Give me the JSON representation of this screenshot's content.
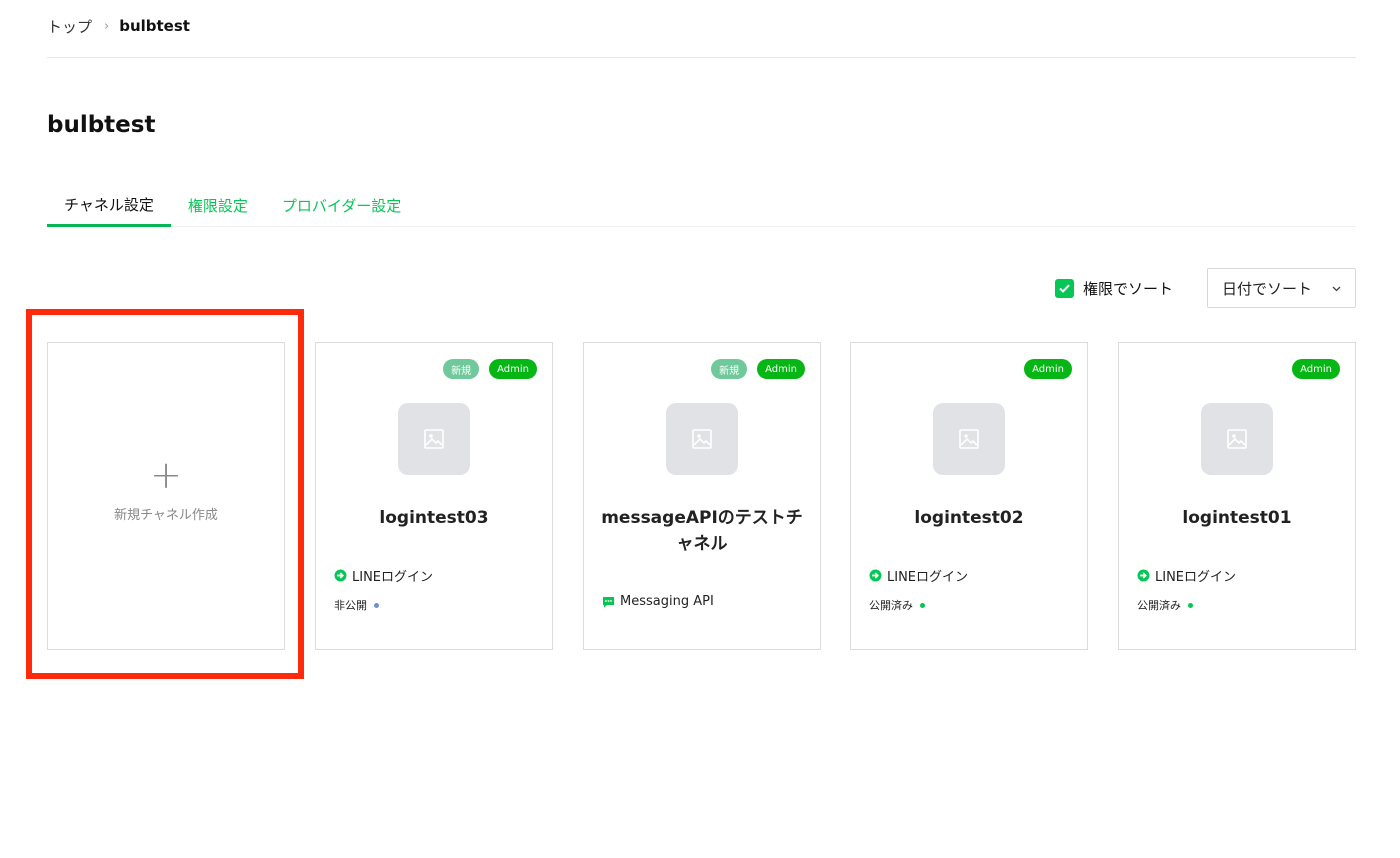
{
  "breadcrumb": {
    "home": "トップ",
    "separator": "›",
    "current": "bulbtest"
  },
  "page_title": "bulbtest",
  "tabs": [
    {
      "label": "チャネル設定",
      "active": true
    },
    {
      "label": "権限設定",
      "active": false
    },
    {
      "label": "プロバイダー設定",
      "active": false
    }
  ],
  "sort": {
    "check_label": "権限でソート",
    "checked": true,
    "select_value": "日付でソート"
  },
  "create_card": {
    "plus": "+",
    "label": "新規チャネル作成"
  },
  "badges": {
    "new": "新規",
    "admin": "Admin"
  },
  "channels": [
    {
      "name": "logintest03",
      "type": "LINEログイン",
      "status": "非公開",
      "status_color": "#6c8fd6",
      "badge_new": true
    },
    {
      "name": "messageAPIのテストチャネル",
      "type": "Messaging API",
      "status": "",
      "badge_new": true
    },
    {
      "name": "logintest02",
      "type": "LINEログイン",
      "status": "公開済み",
      "status_color": "#06c755",
      "badge_new": false
    },
    {
      "name": "logintest01",
      "type": "LINEログイン",
      "status": "公開済み",
      "status_color": "#06c755",
      "badge_new": false
    }
  ],
  "colors": {
    "accent": "#06c755",
    "highlight": "#ff2a0b"
  }
}
